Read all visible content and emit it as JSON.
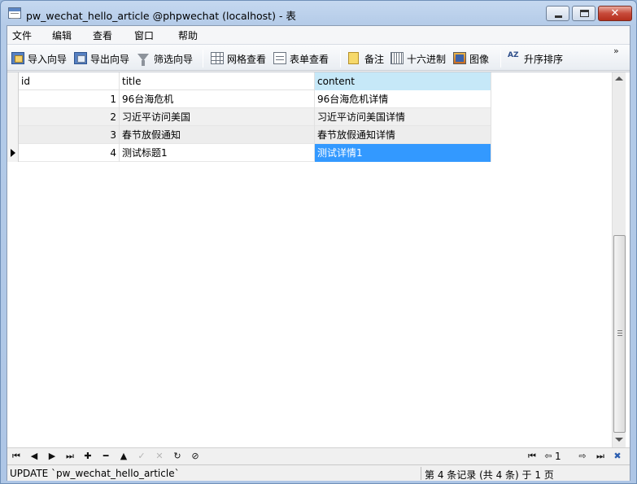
{
  "window": {
    "title": "pw_wechat_hello_article @phpwechat (localhost) - 表",
    "close_glyph": "✕"
  },
  "menu": [
    "文件",
    "编辑",
    "查看",
    "窗口",
    "帮助"
  ],
  "toolbar": {
    "import_wizard": "导入向导",
    "export_wizard": "导出向导",
    "filter_wizard": "筛选向导",
    "grid_view": "网格查看",
    "form_view": "表单查看",
    "memo": "备注",
    "hex": "十六进制",
    "image": "图像",
    "sort_asc": "升序排序",
    "sort_icon_text": "AZ",
    "more": "»"
  },
  "table": {
    "columns": [
      "id",
      "title",
      "content"
    ],
    "rows": [
      {
        "id": "1",
        "title": "96台海危机",
        "content": "96台海危机详情"
      },
      {
        "id": "2",
        "title": "习近平访问美国",
        "content": "习近平访问美国详情"
      },
      {
        "id": "3",
        "title": "春节放假通知",
        "content": "春节放假通知详情"
      },
      {
        "id": "4",
        "title": "测试标题1",
        "content": "测试详情1"
      }
    ],
    "current_row": 4
  },
  "navigator": {
    "first": "⏮",
    "prev": "◀",
    "next": "▶",
    "last": "⏭",
    "add": "✚",
    "delete": "━",
    "up": "▲",
    "apply": "✓",
    "cancel": "✕",
    "refresh": "↻",
    "stop": "⊘",
    "page_first": "⏮",
    "page_prev": "⇦",
    "page_number": "1",
    "page_next": "⇨",
    "page_last": "⏭",
    "settings": "✖"
  },
  "status": {
    "sql": "UPDATE `pw_wechat_hello_article`",
    "record": "第 4 条记录 (共 4 条) 于 1 页"
  }
}
